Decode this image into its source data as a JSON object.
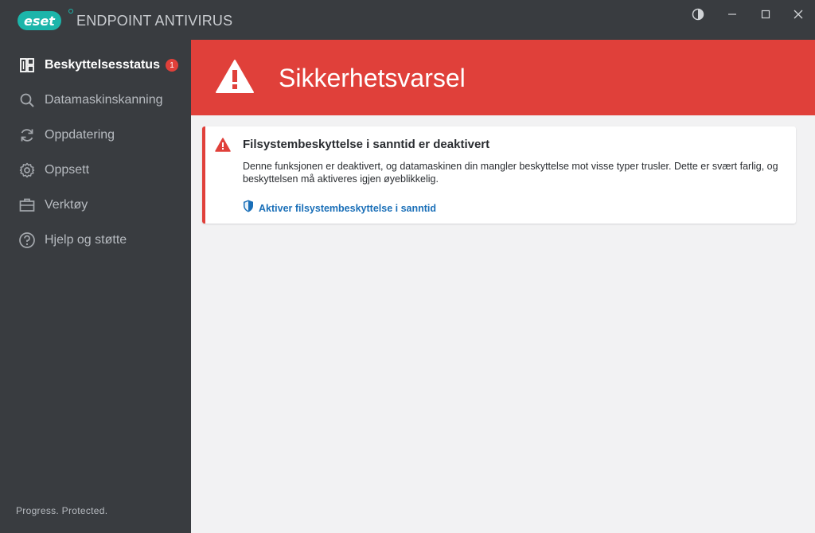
{
  "app": {
    "logo_text": "eset",
    "title": "ENDPOINT ANTIVIRUS"
  },
  "window_controls": [
    "contrast-icon",
    "minimize-icon",
    "maximize-icon",
    "close-icon"
  ],
  "sidebar": {
    "items": [
      {
        "label": "Beskyttelsesstatus",
        "icon": "dashboard-icon",
        "active": true,
        "badge": "1"
      },
      {
        "label": "Datamaskinskanning",
        "icon": "search-icon"
      },
      {
        "label": "Oppdatering",
        "icon": "refresh-icon"
      },
      {
        "label": "Oppsett",
        "icon": "gear-icon"
      },
      {
        "label": "Verktøy",
        "icon": "briefcase-icon"
      },
      {
        "label": "Hjelp og støtte",
        "icon": "help-icon"
      }
    ],
    "footer": "Progress. Protected."
  },
  "banner": {
    "title": "Sikkerhetsvarsel",
    "color": "#e0403a"
  },
  "alert": {
    "title": "Filsystembeskyttelse i sanntid er deaktivert",
    "description": "Denne funksjonen er deaktivert, og datamaskinen din mangler beskyttelse mot visse typer trusler. Dette er svært farlig, og beskyttelsen må aktiveres igjen øyeblikkelig.",
    "action_label": "Aktiver filsystembeskyttelse i sanntid"
  },
  "colors": {
    "accent": "#1cb5aa",
    "danger": "#e0403a",
    "link": "#1a6fb8",
    "sidebar_bg": "#393c40"
  }
}
